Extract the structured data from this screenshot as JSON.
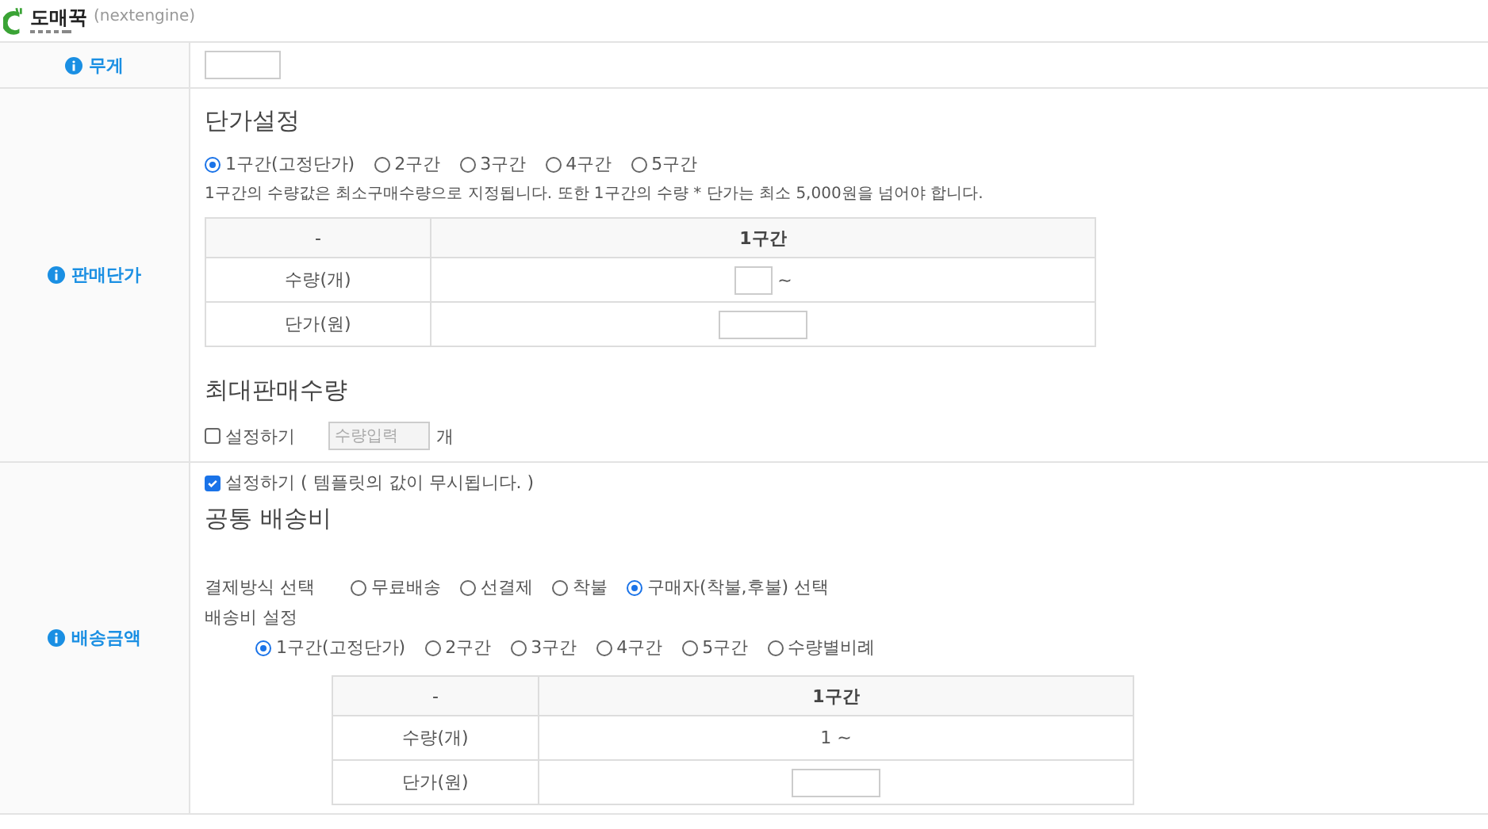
{
  "logo": {
    "name": "도매꾹",
    "subtitle": "(nextengine)"
  },
  "weight": {
    "label": "무게"
  },
  "price": {
    "label": "판매단가",
    "title": "단가설정",
    "tiers": [
      {
        "label": "1구간(고정단가)",
        "selected": true
      },
      {
        "label": "2구간",
        "selected": false
      },
      {
        "label": "3구간",
        "selected": false
      },
      {
        "label": "4구간",
        "selected": false
      },
      {
        "label": "5구간",
        "selected": false
      }
    ],
    "note": "1구간의 수량값은 최소구매수량으로 지정됩니다. 또한 1구간의 수량 * 단가는 최소 5,000원을 넘어야 합니다.",
    "table": {
      "columns": [
        "-",
        "1구간"
      ],
      "rows": [
        {
          "label": "수량(개)",
          "kind": "small-input",
          "suffix": "~"
        },
        {
          "label": "단가(원)",
          "kind": "input"
        }
      ]
    },
    "max_title": "최대판매수량",
    "max_check": {
      "label": "설정하기",
      "checked": false
    },
    "max_input": {
      "placeholder": "수량입력",
      "unit": "개"
    }
  },
  "shipping": {
    "label": "배송금액",
    "override": {
      "label": "설정하기 ( 템플릿의 값이 무시됩니다. )",
      "checked": true
    },
    "title": "공통 배송비",
    "payment_label": "결제방식 선택",
    "payment_options": [
      {
        "label": "무료배송",
        "selected": false
      },
      {
        "label": "선결제",
        "selected": false
      },
      {
        "label": "착불",
        "selected": false
      },
      {
        "label": "구매자(착불,후불) 선택",
        "selected": true
      }
    ],
    "fee_label": "배송비 설정",
    "fee_tiers": [
      {
        "label": "1구간(고정단가)",
        "selected": true
      },
      {
        "label": "2구간",
        "selected": false
      },
      {
        "label": "3구간",
        "selected": false
      },
      {
        "label": "4구간",
        "selected": false
      },
      {
        "label": "5구간",
        "selected": false
      },
      {
        "label": "수량별비례",
        "selected": false
      }
    ],
    "table": {
      "columns": [
        "-",
        "1구간"
      ],
      "rows": [
        {
          "label": "수량(개)",
          "kind": "text",
          "value": "1 ~"
        },
        {
          "label": "단가(원)",
          "kind": "input"
        }
      ]
    }
  }
}
